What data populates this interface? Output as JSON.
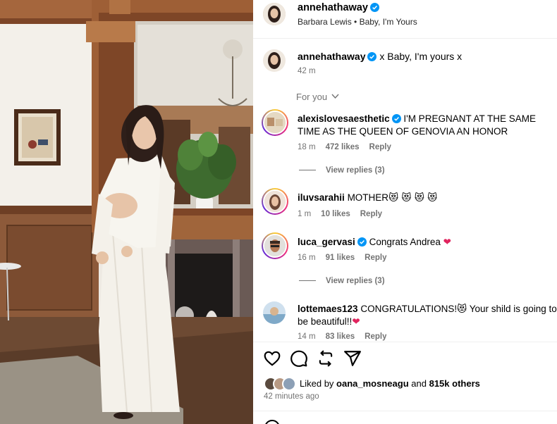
{
  "post": {
    "author": "annehathaway",
    "audio": "Barbara Lewis • Baby, I'm Yours",
    "caption_user": "annehathaway",
    "caption_text": "x Baby, I'm yours x",
    "caption_time": "42 m",
    "for_you_label": "For you"
  },
  "comments": [
    {
      "user": "alexislovesaesthetic",
      "verified": true,
      "text": "I'M PREGNANT AT THE SAME TIME AS THE QUEEN OF GENOVIA AN HONOR",
      "time": "18 m",
      "likes": "472 likes",
      "reply": "Reply",
      "view_replies": "View replies (3)"
    },
    {
      "user": "iluvsarahii",
      "verified": false,
      "text": "MOTHER",
      "emoji": "😻 😻 😻 😻",
      "time": "1 m",
      "likes": "10 likes",
      "reply": "Reply"
    },
    {
      "user": "luca_gervasi",
      "verified": true,
      "text": "Congrats Andrea",
      "emoji": "❤",
      "time": "16 m",
      "likes": "91 likes",
      "reply": "Reply",
      "view_replies": "View replies (3)"
    },
    {
      "user": "lottemaes123",
      "verified": false,
      "text_1": "CONGRATULATIONS!",
      "emoji_1": "😻",
      "text_2": "Your shild is going to be beautiful!!",
      "emoji_2": "❤",
      "time": "14 m",
      "likes": "83 likes",
      "reply": "Reply"
    }
  ],
  "footer": {
    "liked_prefix": "Liked by",
    "liked_user": "oana_mosneagu",
    "liked_and": "and",
    "liked_others": "815k others",
    "time_ago": "42 minutes ago"
  },
  "icons": {
    "like": "heart-icon",
    "comment": "comment-icon",
    "repost": "repost-icon",
    "share": "share-icon",
    "verified": "verified-badge-icon",
    "chevron": "chevron-down-icon"
  },
  "colors": {
    "verified": "#0095f6",
    "muted": "#737373",
    "heart": "#e0245e"
  }
}
